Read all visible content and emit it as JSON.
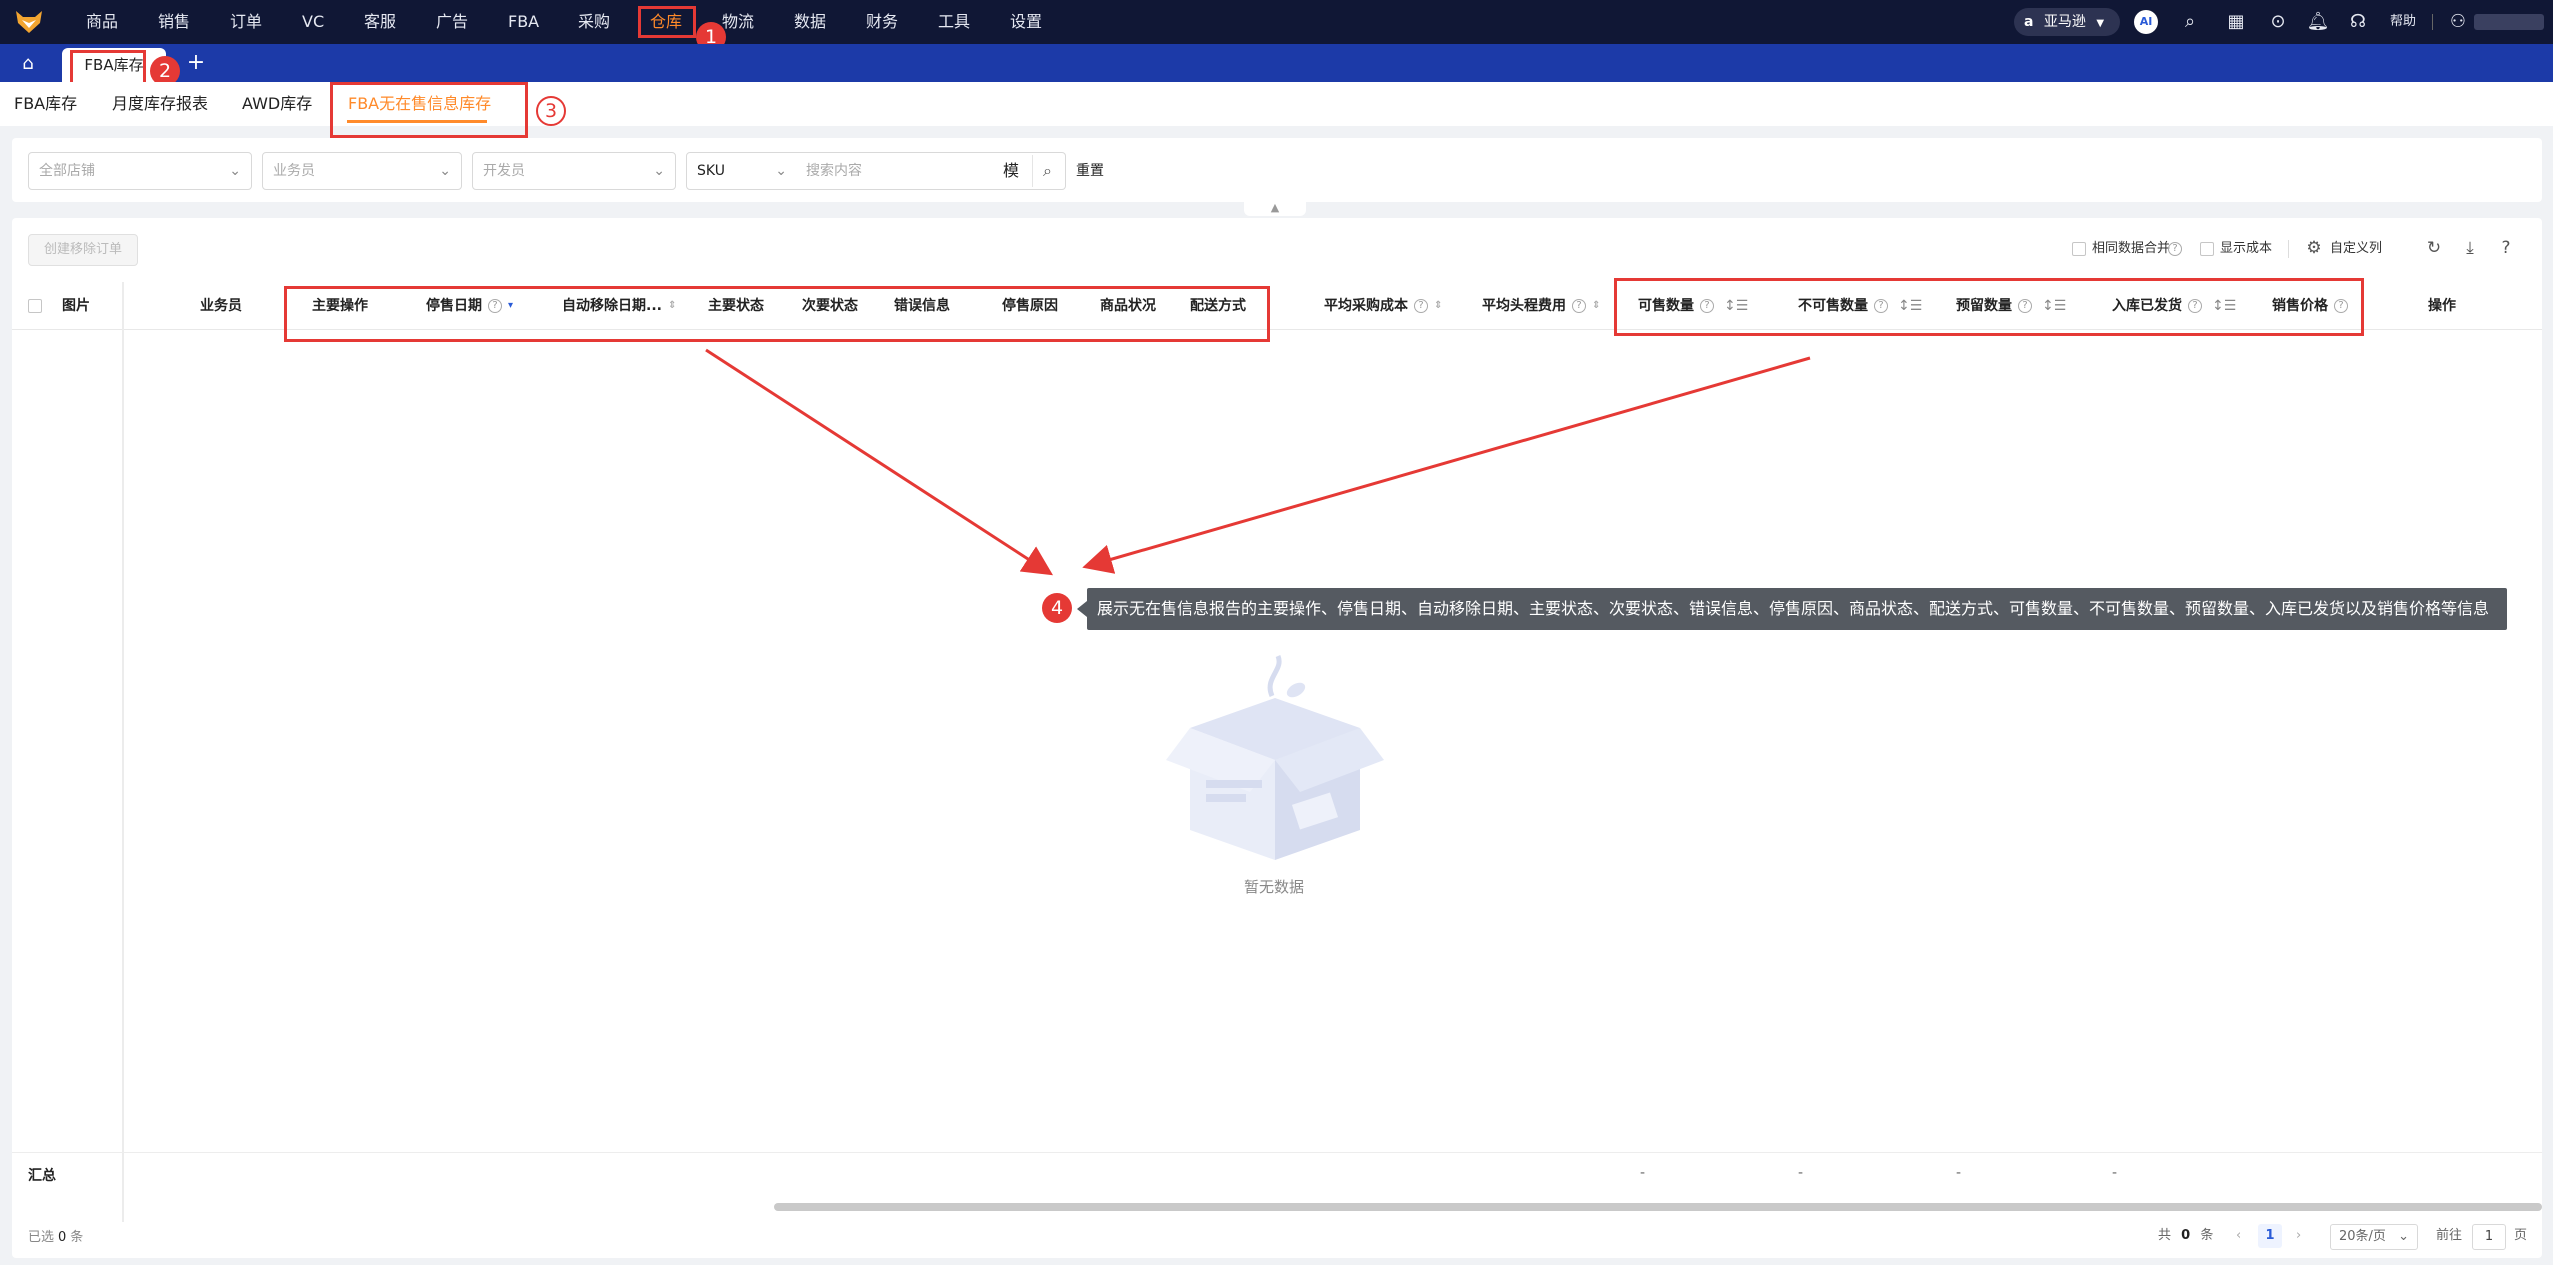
{
  "nav": {
    "items": [
      "商品",
      "销售",
      "订单",
      "VC",
      "客服",
      "广告",
      "FBA",
      "采购",
      "仓库",
      "物流",
      "数据",
      "财务",
      "工具",
      "设置"
    ],
    "active_index": 8,
    "platform": "亚马逊",
    "ai_label": "AI",
    "help_label": "帮助"
  },
  "tabs": {
    "open_tab": "FBA库存",
    "add_symbol": "+"
  },
  "subtabs": {
    "items": [
      "FBA库存",
      "月度库存报表",
      "AWD库存",
      "FBA无在售信息库存"
    ],
    "active_index": 3
  },
  "filters": {
    "store_placeholder": "全部店铺",
    "salesperson_placeholder": "业务员",
    "developer_placeholder": "开发员",
    "field_select": "SKU",
    "search_placeholder": "搜索内容",
    "fuzzy_label": "模",
    "reset_label": "重置"
  },
  "toolbar": {
    "create_removal_order": "创建移除订单",
    "merge_same_data": "相同数据合并",
    "show_cost": "显示成本",
    "custom_columns": "自定义列"
  },
  "table": {
    "headers": {
      "image": "图片",
      "salesperson": "业务员",
      "main_action": "主要操作",
      "stop_sale_date": "停售日期",
      "auto_remove_date": "自动移除日期...",
      "main_status": "主要状态",
      "secondary_status": "次要状态",
      "error_info": "错误信息",
      "stop_reason": "停售原因",
      "item_condition": "商品状况",
      "fulfillment": "配送方式",
      "avg_purchase_cost": "平均采购成本",
      "avg_first_leg_cost": "平均头程费用",
      "sellable_qty": "可售数量",
      "unsellable_qty": "不可售数量",
      "reserved_qty": "预留数量",
      "inbound_shipped": "入库已发货",
      "sale_price": "销售价格",
      "actions": "操作"
    },
    "empty_text": "暂无数据",
    "summary_label": "汇总",
    "summary_values": [
      "-",
      "-",
      "-",
      "-"
    ]
  },
  "annotations": {
    "badges": [
      "1",
      "2",
      "3",
      "4"
    ],
    "callout": "展示无在售信息报告的主要操作、停售日期、自动移除日期、主要状态、次要状态、错误信息、停售原因、商品状态、配送方式、可售数量、不可售数量、预留数量、入库已发货以及销售价格等信息"
  },
  "footer": {
    "selected_prefix": "已选",
    "selected_count": "0",
    "selected_suffix": "条",
    "total_prefix": "共",
    "total_count": "0",
    "total_suffix": "条",
    "current_page": "1",
    "page_size": "20条/页",
    "goto_label": "前往",
    "goto_page": "1",
    "page_suffix": "页"
  },
  "colors": {
    "nav_bg": "#101735",
    "tabbar_bg": "#1c3aa8",
    "accent_orange": "#ff8a2a",
    "annotation_red": "#e53935",
    "callout_bg": "#555a61"
  }
}
